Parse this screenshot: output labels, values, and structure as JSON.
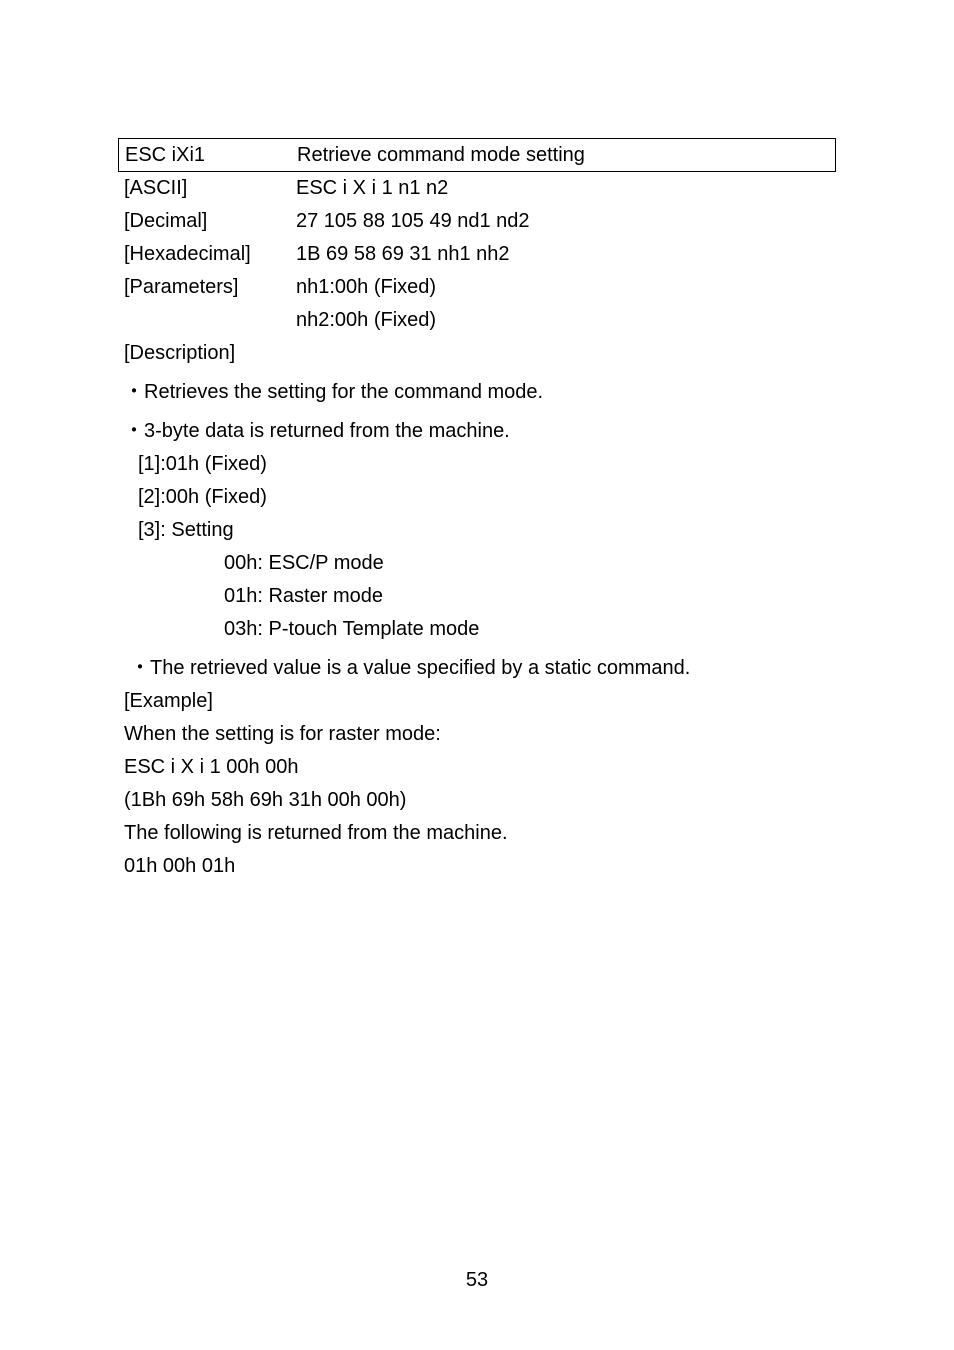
{
  "header": {
    "cmd": "ESC iXi1",
    "title": "Retrieve command mode setting"
  },
  "defs": [
    {
      "label": "[ASCII]",
      "value": "ESC i X i 1 n1 n2"
    },
    {
      "label": "[Decimal]",
      "value": "27 105 88 105 49 nd1 nd2"
    },
    {
      "label": "[Hexadecimal]",
      "value": "1B 69 58 69 31 nh1 nh2"
    },
    {
      "label": "[Parameters]",
      "value": "nh1:00h (Fixed)"
    },
    {
      "label": "",
      "value": "nh2:00h (Fixed)"
    }
  ],
  "sections": {
    "description_label": "[Description]",
    "bullet1": "・Retrieves the setting for the command mode.",
    "bullet2": "・3-byte data is returned from the machine.",
    "byte1": "[1]:01h (Fixed)",
    "byte2": "[2]:00h (Fixed)",
    "byte3": "[3]: Setting",
    "setting_00h": "00h: ESC/P mode",
    "setting_01h": "01h: Raster mode",
    "setting_03h": "03h: P-touch Template mode",
    "bullet3": "・The retrieved value is a value specified by a static command.",
    "example_label": "[Example]",
    "example_line1": "When the setting is for raster mode:",
    "example_line2": "ESC i X i 1 00h 00h",
    "example_line3": "(1Bh 69h 58h 69h 31h 00h 00h)",
    "example_line4": "The following is returned from the machine.",
    "example_line5": "01h 00h 01h"
  },
  "page_number": "53"
}
